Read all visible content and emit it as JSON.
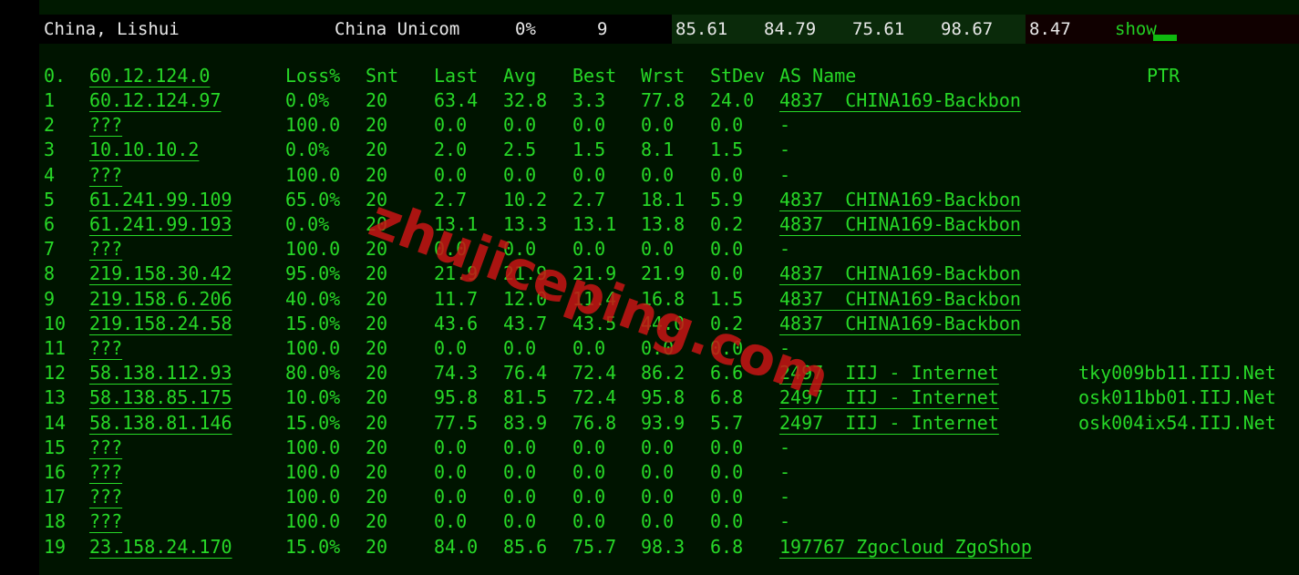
{
  "summary": {
    "location": "China, Lishui",
    "isp": "China Unicom",
    "loss": "0%",
    "sent": "9",
    "v1": "85.61",
    "v2": "84.79",
    "v3": "75.61",
    "v4": "98.67",
    "v5": "8.47",
    "show_label": "show"
  },
  "header": {
    "hop": "0.",
    "host": "60.12.124.0",
    "loss": "Loss%",
    "snt": "Snt",
    "last": "Last",
    "avg": "Avg",
    "best": "Best",
    "wrst": "Wrst",
    "stdev": "StDev",
    "asname": "AS Name",
    "ptr": "PTR"
  },
  "rows": [
    {
      "hop": "1",
      "host": "60.12.124.97",
      "loss": "0.0%",
      "snt": "20",
      "last": "63.4",
      "avg": "32.8",
      "best": "3.3",
      "wrst": "77.8",
      "stdev": "24.0",
      "as": "4837  CHINA169-Backbon",
      "ptr": ""
    },
    {
      "hop": "2",
      "host": "???",
      "loss": "100.0",
      "snt": "20",
      "last": "0.0",
      "avg": "0.0",
      "best": "0.0",
      "wrst": "0.0",
      "stdev": "0.0",
      "as": "-",
      "ptr": ""
    },
    {
      "hop": "3",
      "host": "10.10.10.2",
      "loss": "0.0%",
      "snt": "20",
      "last": "2.0",
      "avg": "2.5",
      "best": "1.5",
      "wrst": "8.1",
      "stdev": "1.5",
      "as": "-",
      "ptr": ""
    },
    {
      "hop": "4",
      "host": "???",
      "loss": "100.0",
      "snt": "20",
      "last": "0.0",
      "avg": "0.0",
      "best": "0.0",
      "wrst": "0.0",
      "stdev": "0.0",
      "as": "-",
      "ptr": ""
    },
    {
      "hop": "5",
      "host": "61.241.99.109",
      "loss": "65.0%",
      "snt": "20",
      "last": "2.7",
      "avg": "10.2",
      "best": "2.7",
      "wrst": "18.1",
      "stdev": "5.9",
      "as": "4837  CHINA169-Backbon",
      "ptr": ""
    },
    {
      "hop": "6",
      "host": "61.241.99.193",
      "loss": "0.0%",
      "snt": "20",
      "last": "13.1",
      "avg": "13.3",
      "best": "13.1",
      "wrst": "13.8",
      "stdev": "0.2",
      "as": "4837  CHINA169-Backbon",
      "ptr": ""
    },
    {
      "hop": "7",
      "host": "???",
      "loss": "100.0",
      "snt": "20",
      "last": "0.0",
      "avg": "0.0",
      "best": "0.0",
      "wrst": "0.0",
      "stdev": "0.0",
      "as": "-",
      "ptr": ""
    },
    {
      "hop": "8",
      "host": "219.158.30.42",
      "loss": "95.0%",
      "snt": "20",
      "last": "21.9",
      "avg": "21.9",
      "best": "21.9",
      "wrst": "21.9",
      "stdev": "0.0",
      "as": "4837  CHINA169-Backbon",
      "ptr": ""
    },
    {
      "hop": "9",
      "host": "219.158.6.206",
      "loss": "40.0%",
      "snt": "20",
      "last": "11.7",
      "avg": "12.0",
      "best": "11.4",
      "wrst": "16.8",
      "stdev": "1.5",
      "as": "4837  CHINA169-Backbon",
      "ptr": ""
    },
    {
      "hop": "10",
      "host": "219.158.24.58",
      "loss": "15.0%",
      "snt": "20",
      "last": "43.6",
      "avg": "43.7",
      "best": "43.5",
      "wrst": "44.0",
      "stdev": "0.2",
      "as": "4837  CHINA169-Backbon",
      "ptr": ""
    },
    {
      "hop": "11",
      "host": "???",
      "loss": "100.0",
      "snt": "20",
      "last": "0.0",
      "avg": "0.0",
      "best": "0.0",
      "wrst": "0.0",
      "stdev": "0.0",
      "as": "-",
      "ptr": ""
    },
    {
      "hop": "12",
      "host": "58.138.112.93",
      "loss": "80.0%",
      "snt": "20",
      "last": "74.3",
      "avg": "76.4",
      "best": "72.4",
      "wrst": "86.2",
      "stdev": "6.6",
      "as": "2497  IIJ - Internet",
      "ptr": "tky009bb11.IIJ.Net"
    },
    {
      "hop": "13",
      "host": "58.138.85.175",
      "loss": "10.0%",
      "snt": "20",
      "last": "95.8",
      "avg": "81.5",
      "best": "72.4",
      "wrst": "95.8",
      "stdev": "6.8",
      "as": "2497  IIJ - Internet",
      "ptr": "osk011bb01.IIJ.Net"
    },
    {
      "hop": "14",
      "host": "58.138.81.146",
      "loss": "15.0%",
      "snt": "20",
      "last": "77.5",
      "avg": "83.9",
      "best": "76.8",
      "wrst": "93.9",
      "stdev": "5.7",
      "as": "2497  IIJ - Internet",
      "ptr": "osk004ix54.IIJ.Net"
    },
    {
      "hop": "15",
      "host": "???",
      "loss": "100.0",
      "snt": "20",
      "last": "0.0",
      "avg": "0.0",
      "best": "0.0",
      "wrst": "0.0",
      "stdev": "0.0",
      "as": "-",
      "ptr": ""
    },
    {
      "hop": "16",
      "host": "???",
      "loss": "100.0",
      "snt": "20",
      "last": "0.0",
      "avg": "0.0",
      "best": "0.0",
      "wrst": "0.0",
      "stdev": "0.0",
      "as": "-",
      "ptr": ""
    },
    {
      "hop": "17",
      "host": "???",
      "loss": "100.0",
      "snt": "20",
      "last": "0.0",
      "avg": "0.0",
      "best": "0.0",
      "wrst": "0.0",
      "stdev": "0.0",
      "as": "-",
      "ptr": ""
    },
    {
      "hop": "18",
      "host": "???",
      "loss": "100.0",
      "snt": "20",
      "last": "0.0",
      "avg": "0.0",
      "best": "0.0",
      "wrst": "0.0",
      "stdev": "0.0",
      "as": "-",
      "ptr": ""
    },
    {
      "hop": "19",
      "host": "23.158.24.170",
      "loss": "15.0%",
      "snt": "20",
      "last": "84.0",
      "avg": "85.6",
      "best": "75.7",
      "wrst": "98.3",
      "stdev": "6.8",
      "as": "197767 Zgocloud ZgoShop",
      "ptr": ""
    }
  ],
  "watermark": "zhujiceping.com",
  "colors": {
    "text": "#27d827",
    "background": "#001400",
    "watermark": "#c81414"
  }
}
